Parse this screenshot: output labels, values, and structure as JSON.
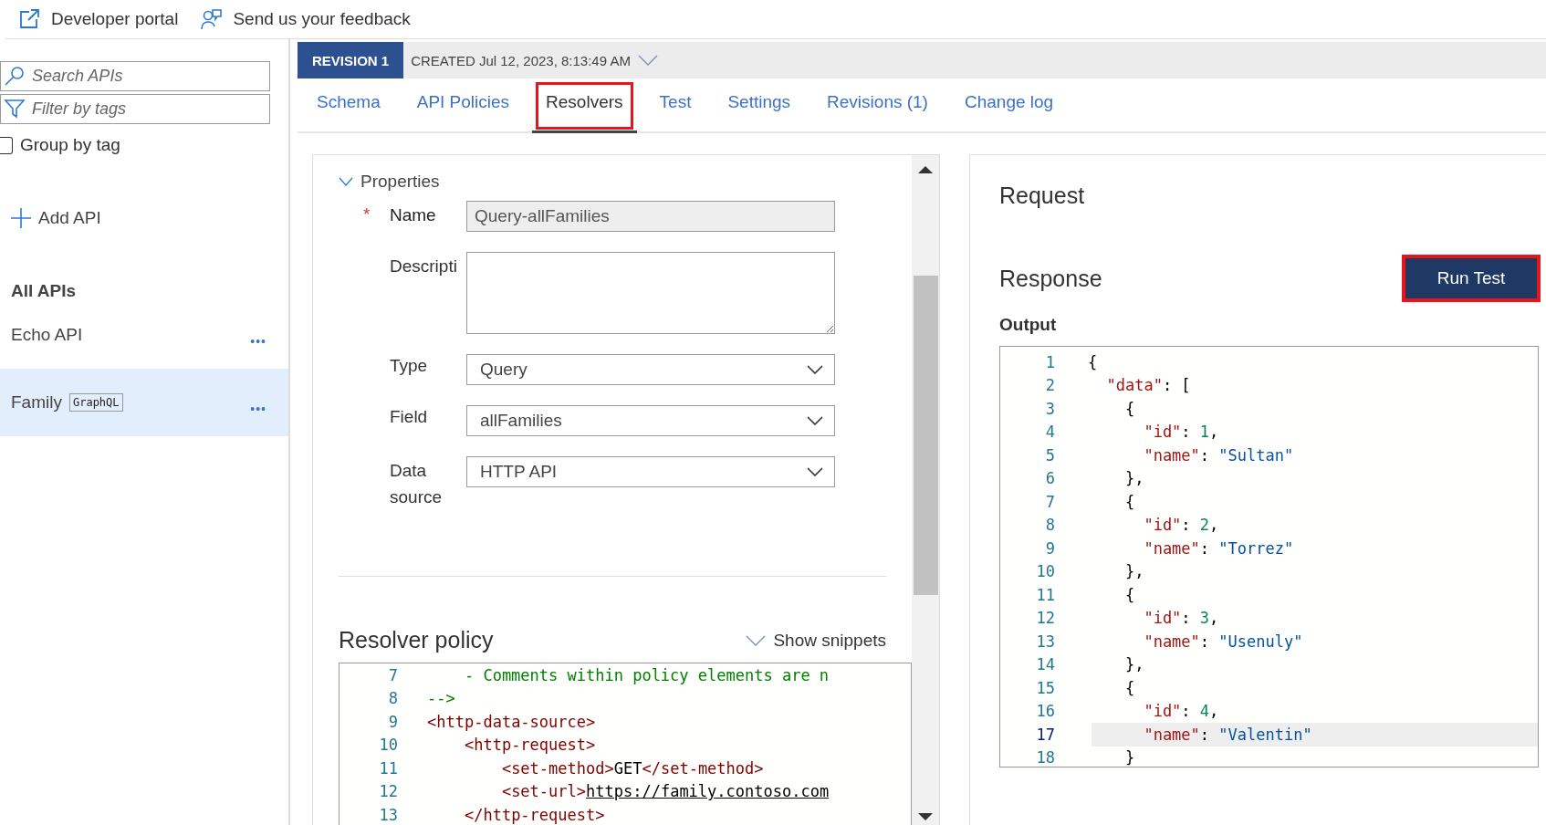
{
  "top_bar": {
    "links": [
      {
        "kind": "external",
        "label": "Developer portal"
      },
      {
        "kind": "feedback",
        "label": "Send us your feedback"
      }
    ]
  },
  "sidebar": {
    "search": {
      "placeholder": "Search APIs"
    },
    "filter": {
      "placeholder": "Filter by tags"
    },
    "group_by_tag": {
      "label": "Group by tag",
      "checked": false
    },
    "add_api": "Add API",
    "heading": "All APIs",
    "apis": [
      {
        "name": "Echo API",
        "selected": false,
        "more": "•••"
      },
      {
        "name": "Family",
        "tag": "GraphQL",
        "selected": true,
        "more": "•••"
      }
    ]
  },
  "revision": {
    "badge": "REVISION 1",
    "created": "CREATED Jul 12, 2023, 8:13:49 AM"
  },
  "tabs": [
    {
      "label": "Schema",
      "selected": false,
      "highlighted": false
    },
    {
      "label": "API Policies",
      "selected": false,
      "highlighted": false
    },
    {
      "label": "Resolvers",
      "selected": true,
      "highlighted": true
    },
    {
      "label": "Test",
      "selected": false,
      "highlighted": false
    },
    {
      "label": "Settings",
      "selected": false,
      "highlighted": false
    },
    {
      "label": "Revisions (1)",
      "selected": false,
      "highlighted": false
    },
    {
      "label": "Change log",
      "selected": false,
      "highlighted": false
    }
  ],
  "properties": {
    "title": "Properties",
    "expanded": true,
    "required_mark": "*",
    "fields": [
      {
        "kind": "text",
        "label": "Name",
        "required": true,
        "value": "Query-allFamilies",
        "disabled": true
      },
      {
        "kind": "textarea",
        "label": "Descripti",
        "required": false,
        "disabled": false
      },
      {
        "kind": "select",
        "label": "Type",
        "required": false,
        "value": "Query",
        "disabled": false
      },
      {
        "kind": "select",
        "label": "Field",
        "required": false,
        "value": "allFamilies",
        "disabled": false
      },
      {
        "kind": "select",
        "label": "Data source",
        "required": false,
        "value": "HTTP API",
        "disabled": false
      }
    ]
  },
  "resolver_policy": {
    "title": "Resolver policy",
    "show_snippets": "Show snippets",
    "lines": [
      {
        "number": "7",
        "tokens": [
          {
            "kind": "comment",
            "text": "    - Comments within policy elements are n"
          }
        ]
      },
      {
        "number": "8",
        "tokens": [
          {
            "kind": "comment",
            "text": "-->"
          }
        ]
      },
      {
        "number": "9",
        "tokens": [
          {
            "kind": "punct",
            "text": "<"
          },
          {
            "kind": "tag",
            "text": "http-data-source"
          },
          {
            "kind": "punct",
            "text": ">"
          }
        ]
      },
      {
        "number": "10",
        "tokens": [
          {
            "kind": "punct",
            "text": "    <"
          },
          {
            "kind": "tag",
            "text": "http-request"
          },
          {
            "kind": "punct",
            "text": ">"
          }
        ]
      },
      {
        "number": "11",
        "tokens": [
          {
            "kind": "punct",
            "text": "        <"
          },
          {
            "kind": "tag",
            "text": "set-method"
          },
          {
            "kind": "punct",
            "text": ">"
          },
          {
            "kind": "text",
            "text": "GET"
          },
          {
            "kind": "punct",
            "text": "</"
          },
          {
            "kind": "tag",
            "text": "set-method"
          },
          {
            "kind": "punct",
            "text": ">"
          }
        ]
      },
      {
        "number": "12",
        "tokens": [
          {
            "kind": "punct",
            "text": "        <"
          },
          {
            "kind": "tag",
            "text": "set-url"
          },
          {
            "kind": "punct",
            "text": ">"
          },
          {
            "kind": "url",
            "text": "https://family.contoso.com"
          }
        ]
      },
      {
        "number": "13",
        "tokens": [
          {
            "kind": "punct",
            "text": "    </"
          },
          {
            "kind": "tag",
            "text": "http-request"
          },
          {
            "kind": "punct",
            "text": ">"
          }
        ]
      }
    ]
  },
  "test": {
    "request_title": "Request",
    "response_title": "Response",
    "run_button": {
      "label": "Run Test",
      "highlighted": true
    },
    "output_label": "Output",
    "lines": [
      {
        "number": "1",
        "current": false,
        "tokens": [
          {
            "kind": "punct",
            "text": "{"
          }
        ]
      },
      {
        "number": "2",
        "current": false,
        "tokens": [
          {
            "kind": "key",
            "text": "  \"data\""
          },
          {
            "kind": "punct",
            "text": ": ["
          }
        ]
      },
      {
        "number": "3",
        "current": false,
        "tokens": [
          {
            "kind": "punct",
            "text": "    {"
          }
        ]
      },
      {
        "number": "4",
        "current": false,
        "tokens": [
          {
            "kind": "key",
            "text": "      \"id\""
          },
          {
            "kind": "punct",
            "text": ": "
          },
          {
            "kind": "number",
            "text": "1"
          },
          {
            "kind": "punct",
            "text": ","
          }
        ]
      },
      {
        "number": "5",
        "current": false,
        "tokens": [
          {
            "kind": "key",
            "text": "      \"name\""
          },
          {
            "kind": "punct",
            "text": ": "
          },
          {
            "kind": "string",
            "text": "\"Sultan\""
          }
        ]
      },
      {
        "number": "6",
        "current": false,
        "tokens": [
          {
            "kind": "punct",
            "text": "    },"
          }
        ]
      },
      {
        "number": "7",
        "current": false,
        "tokens": [
          {
            "kind": "punct",
            "text": "    {"
          }
        ]
      },
      {
        "number": "8",
        "current": false,
        "tokens": [
          {
            "kind": "key",
            "text": "      \"id\""
          },
          {
            "kind": "punct",
            "text": ": "
          },
          {
            "kind": "number",
            "text": "2"
          },
          {
            "kind": "punct",
            "text": ","
          }
        ]
      },
      {
        "number": "9",
        "current": false,
        "tokens": [
          {
            "kind": "key",
            "text": "      \"name\""
          },
          {
            "kind": "punct",
            "text": ": "
          },
          {
            "kind": "string",
            "text": "\"Torrez\""
          }
        ]
      },
      {
        "number": "10",
        "current": false,
        "tokens": [
          {
            "kind": "punct",
            "text": "    },"
          }
        ]
      },
      {
        "number": "11",
        "current": false,
        "tokens": [
          {
            "kind": "punct",
            "text": "    {"
          }
        ]
      },
      {
        "number": "12",
        "current": false,
        "tokens": [
          {
            "kind": "key",
            "text": "      \"id\""
          },
          {
            "kind": "punct",
            "text": ": "
          },
          {
            "kind": "number",
            "text": "3"
          },
          {
            "kind": "punct",
            "text": ","
          }
        ]
      },
      {
        "number": "13",
        "current": false,
        "tokens": [
          {
            "kind": "key",
            "text": "      \"name\""
          },
          {
            "kind": "punct",
            "text": ": "
          },
          {
            "kind": "string",
            "text": "\"Usenuly\""
          }
        ]
      },
      {
        "number": "14",
        "current": false,
        "tokens": [
          {
            "kind": "punct",
            "text": "    },"
          }
        ]
      },
      {
        "number": "15",
        "current": false,
        "tokens": [
          {
            "kind": "punct",
            "text": "    {"
          }
        ]
      },
      {
        "number": "16",
        "current": false,
        "tokens": [
          {
            "kind": "key",
            "text": "      \"id\""
          },
          {
            "kind": "punct",
            "text": ": "
          },
          {
            "kind": "number",
            "text": "4"
          },
          {
            "kind": "punct",
            "text": ","
          }
        ]
      },
      {
        "number": "17",
        "current": true,
        "tokens": [
          {
            "kind": "key",
            "text": "      \"name\""
          },
          {
            "kind": "punct",
            "text": ": "
          },
          {
            "kind": "string",
            "text": "\"Valentin\""
          }
        ]
      },
      {
        "number": "18",
        "current": false,
        "tokens": [
          {
            "kind": "punct",
            "text": "    }"
          }
        ]
      }
    ]
  }
}
